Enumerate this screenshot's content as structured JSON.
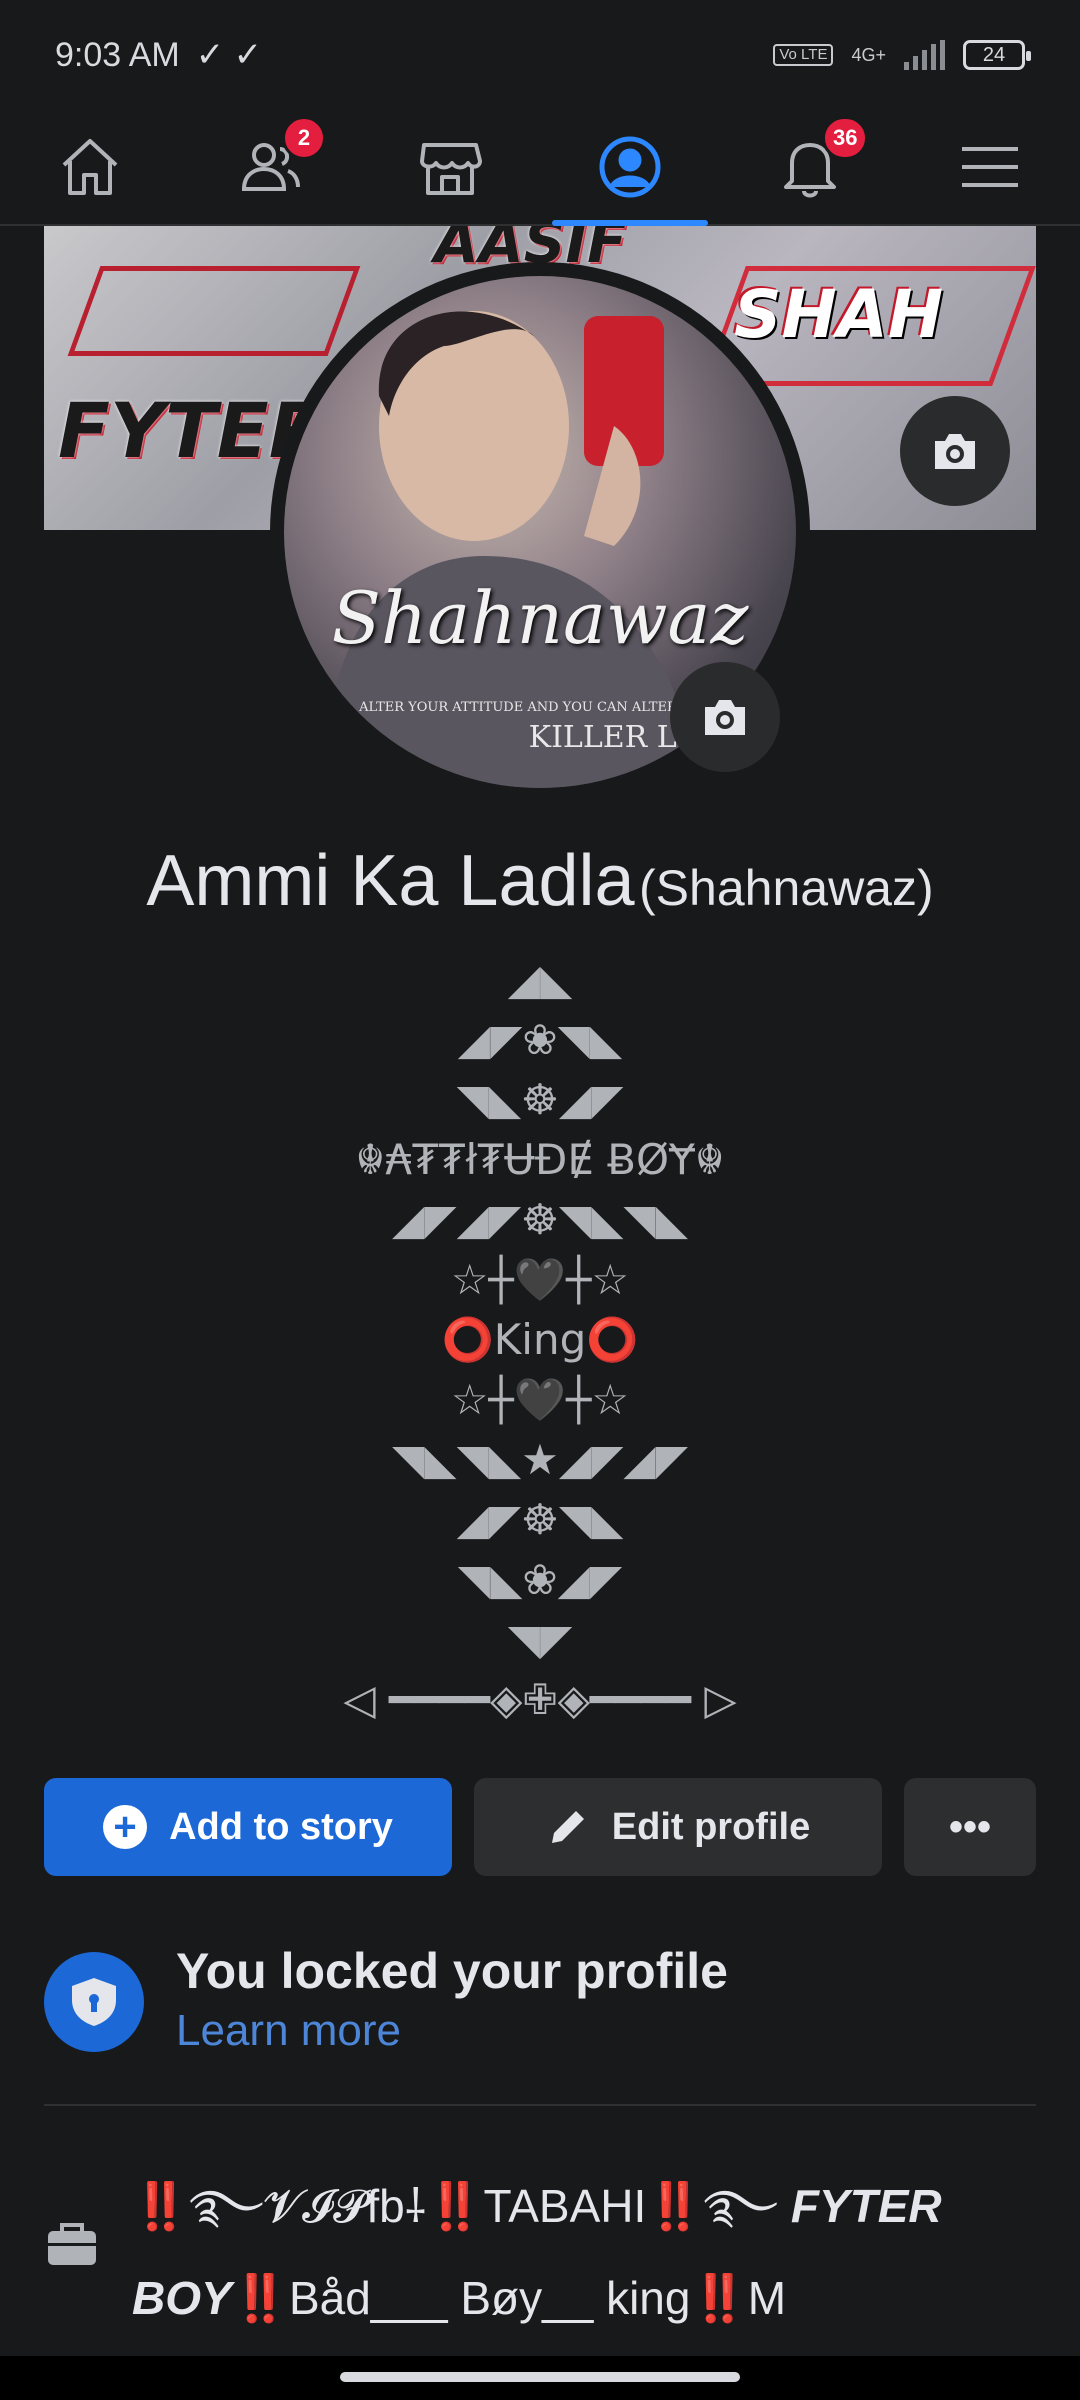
{
  "status_bar": {
    "time": "9:03 AM",
    "checks": "✓ ✓",
    "volte": "Vo LTE",
    "network": "4G+",
    "battery": "24"
  },
  "nav": {
    "friends_badge": "2",
    "notifications_badge": "36",
    "active_tab": "profile"
  },
  "cover": {
    "tag_top": "AASIF",
    "tag_right": "SHAH",
    "tag_left": "FYTER B"
  },
  "avatar": {
    "signature": "Shahnawaz",
    "caption": "ALTER YOUR ATTITUDE AND YOU CAN ALTER YOUR",
    "brand": "KILLER LO"
  },
  "profile": {
    "name": "Ammi Ka Ladla",
    "alternate_name": "(Shahnawaz)"
  },
  "bio": [
    "◢◣",
    "◢◤❀◥◣",
    "◥◣☸◢◤",
    "☬₳₮₮ł₮ɄĐɆ ɃØɎ☬",
    "◢◤◢◤☸◥◣◥◣",
    "☆┼🖤┼☆",
    "⭕King⭕",
    "☆┼🖤┼☆",
    "◥◣◥◣★◢◤◢◤",
    "◢◤☸◥◣",
    "◥◣❀◢◤",
    "◥◤",
    "◁ ━━━━◈✙◈━━━━ ▷"
  ],
  "actions": {
    "add_story": "Add to story",
    "edit_profile": "Edit profile",
    "more": "•••"
  },
  "locked": {
    "title": "You locked your profile",
    "link": "Learn more"
  },
  "work": {
    "line1_a": "‼️࿐𝓥𝓘𝓟fb",
    "line1_b": "‼️TABAHI‼️࿐",
    "line1_c": "FYTER",
    "line2_a": "BOY",
    "line2_b": "‼️Båd___ Bøy__ king‼️M"
  },
  "colors": {
    "background": "#18191a",
    "accent": "#1b68d6",
    "badge": "#e41e3f",
    "link": "#4d86d8"
  }
}
